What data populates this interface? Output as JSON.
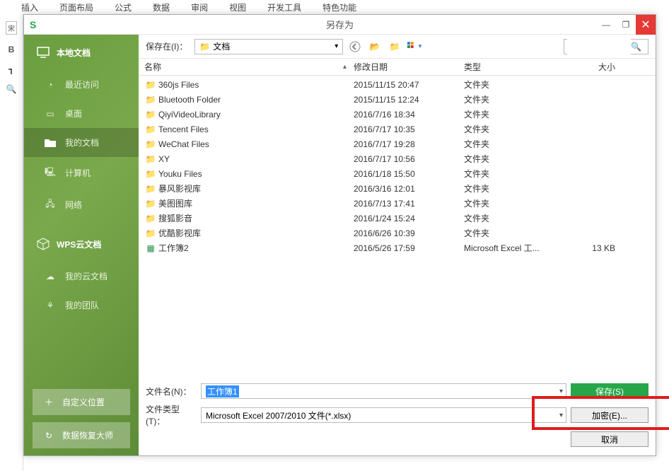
{
  "ribbon": {
    "tabs": [
      "插入",
      "页面布局",
      "公式",
      "数据",
      "审阅",
      "视图",
      "开发工具",
      "特色功能"
    ]
  },
  "left_margin": {
    "style_label": "宋",
    "bold": "B"
  },
  "dialog": {
    "title": "另存为",
    "icon": "S",
    "window_buttons": {
      "minimize": "—",
      "restore": "❐",
      "close": "✕"
    }
  },
  "sidebar": {
    "header": "本地文档",
    "items": [
      "最近访问",
      "桌面",
      "我的文档",
      "计算机",
      "网络"
    ],
    "cloud_header": "WPS云文档",
    "cloud_items": [
      "我的云文档",
      "我的团队"
    ],
    "bottom_buttons": [
      "自定义位置",
      "数据恢复大师"
    ]
  },
  "toolbar": {
    "save_in_label": "保存在(I)：",
    "location": "文档",
    "icons": {
      "view_caret": "▾"
    },
    "search_placeholder": ""
  },
  "columns": {
    "name": "名称",
    "date": "修改日期",
    "type": "类型",
    "size": "大小",
    "sort": "▴"
  },
  "files": [
    {
      "icon": "folder",
      "name": "360js Files",
      "date": "2015/11/15 20:47",
      "type": "文件夹",
      "size": ""
    },
    {
      "icon": "folder",
      "name": "Bluetooth Folder",
      "date": "2015/11/15 12:24",
      "type": "文件夹",
      "size": ""
    },
    {
      "icon": "folder",
      "name": "QiyiVideoLibrary",
      "date": "2016/7/16 18:34",
      "type": "文件夹",
      "size": ""
    },
    {
      "icon": "folder",
      "name": "Tencent Files",
      "date": "2016/7/17 10:35",
      "type": "文件夹",
      "size": ""
    },
    {
      "icon": "folder",
      "name": "WeChat Files",
      "date": "2016/7/17 19:28",
      "type": "文件夹",
      "size": ""
    },
    {
      "icon": "folder",
      "name": "XY",
      "date": "2016/7/17 10:56",
      "type": "文件夹",
      "size": ""
    },
    {
      "icon": "folder",
      "name": "Youku Files",
      "date": "2016/1/18 15:50",
      "type": "文件夹",
      "size": ""
    },
    {
      "icon": "folder",
      "name": "暴风影视库",
      "date": "2016/3/16 12:01",
      "type": "文件夹",
      "size": ""
    },
    {
      "icon": "folder",
      "name": "美图图库",
      "date": "2016/7/13 17:41",
      "type": "文件夹",
      "size": ""
    },
    {
      "icon": "folder",
      "name": "搜狐影音",
      "date": "2016/1/24 15:24",
      "type": "文件夹",
      "size": ""
    },
    {
      "icon": "folder",
      "name": "优酷影视库",
      "date": "2016/6/26 10:39",
      "type": "文件夹",
      "size": ""
    },
    {
      "icon": "xls",
      "name": "工作簿2",
      "date": "2016/5/26 17:59",
      "type": "Microsoft Excel 工...",
      "size": "13 KB"
    }
  ],
  "footer": {
    "filename_label": "文件名(N)：",
    "filename_value": "工作簿1",
    "filetype_label": "文件类型(T)：",
    "filetype_value": "Microsoft Excel 2007/2010 文件(*.xlsx)",
    "save_btn": "保存(S)",
    "encrypt_btn": "加密(E)...",
    "cancel_btn": "取消"
  }
}
